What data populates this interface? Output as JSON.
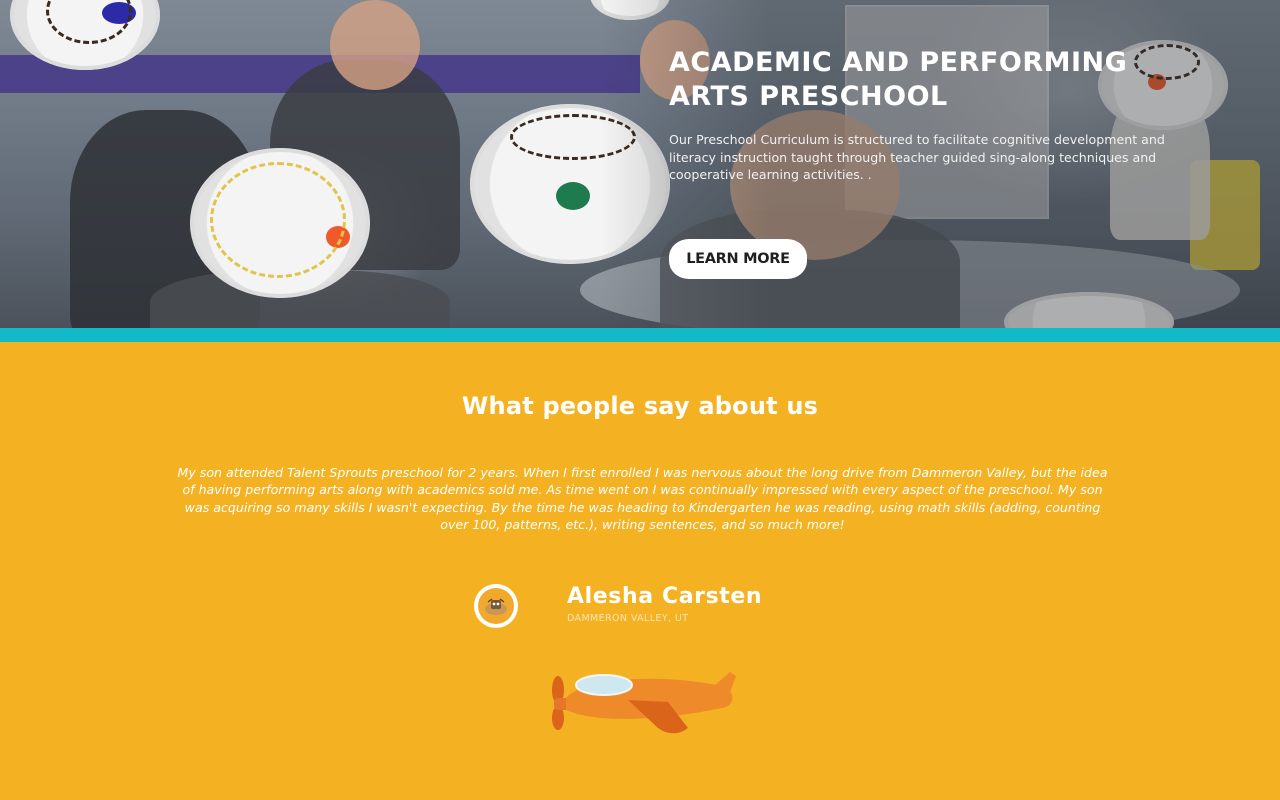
{
  "hero": {
    "title": "ACADEMIC AND PERFORMING ARTS PRESCHOOL",
    "description": "Our Preschool Curriculum is structured to facilitate cognitive development and literacy instruction taught through teacher guided sing-along techniques and cooperative learning activities. .",
    "button_label": "LEARN MORE"
  },
  "testimonials": {
    "heading": "What people say about us",
    "quote": "My son attended Talent Sprouts preschool for 2 years. When I first enrolled I was nervous about the long drive from Dammeron Valley, but the idea of having performing arts along with academics sold me. As time went on I was continually impressed with every aspect of the preschool. My son was acquiring so many skills I wasn't expecting. By the time he was heading to Kindergarten he was reading, using math skills (adding, counting over 100, patterns, etc.), writing sentences, and so much more!",
    "author_name": "Alesha Carsten",
    "author_location": "DAMMERON VALLEY, UT"
  },
  "colors": {
    "section_background": "#f4b223",
    "accent_bar": "#12b9c6",
    "button_background": "#ffffff",
    "plane_body": "#ef8a2b",
    "plane_wing": "#d9641a"
  },
  "icons": {
    "avatar": "avatar-illustration",
    "decoration": "airplane-icon"
  }
}
